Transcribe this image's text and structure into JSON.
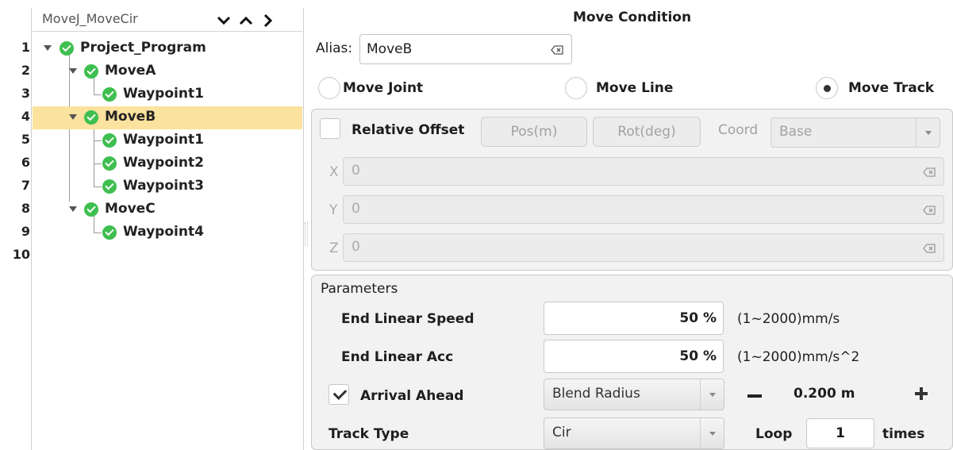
{
  "tree": {
    "title": "MoveJ_MoveCir",
    "line_numbers": [
      "1",
      "2",
      "3",
      "4",
      "5",
      "6",
      "7",
      "8",
      "9",
      "10"
    ],
    "nodes": [
      {
        "label": "Project_Program"
      },
      {
        "label": "MoveA"
      },
      {
        "label": "Waypoint1"
      },
      {
        "label": "MoveB"
      },
      {
        "label": "Waypoint1"
      },
      {
        "label": "Waypoint2"
      },
      {
        "label": "Waypoint3"
      },
      {
        "label": "MoveC"
      },
      {
        "label": "Waypoint4"
      }
    ],
    "selected_node": "MoveB"
  },
  "condition": {
    "title": "Move Condition",
    "alias_label": "Alias:",
    "alias_value": "MoveB",
    "move_types": [
      "Move Joint",
      "Move Line",
      "Move Track"
    ],
    "selected_move_type": "Move Track"
  },
  "offset": {
    "label": "Relative Offset",
    "checked": false,
    "pos_button": "Pos(m)",
    "rot_button": "Rot(deg)",
    "coord_label": "Coord",
    "coord_value": "Base",
    "axes": [
      {
        "label": "X",
        "value": "0"
      },
      {
        "label": "Y",
        "value": "0"
      },
      {
        "label": "Z",
        "value": "0"
      }
    ]
  },
  "params": {
    "title": "Parameters",
    "end_linear_speed": {
      "label": "End Linear Speed",
      "value": "50 %",
      "unit": "(1~2000)mm/s"
    },
    "end_linear_acc": {
      "label": "End Linear Acc",
      "value": "50 %",
      "unit": "(1~2000)mm/s^2"
    },
    "arrival_ahead": {
      "label": "Arrival Ahead",
      "checked": true,
      "mode": "Blend Radius",
      "value": "0.200 m"
    },
    "track_type": {
      "label": "Track Type",
      "value": "Cir"
    },
    "loop": {
      "label": "Loop",
      "value": "1",
      "suffix": "times"
    }
  },
  "colors": {
    "selection": "#fbe29e",
    "check_green": "#3fbf50",
    "panel_bg": "#f2f2f2"
  }
}
